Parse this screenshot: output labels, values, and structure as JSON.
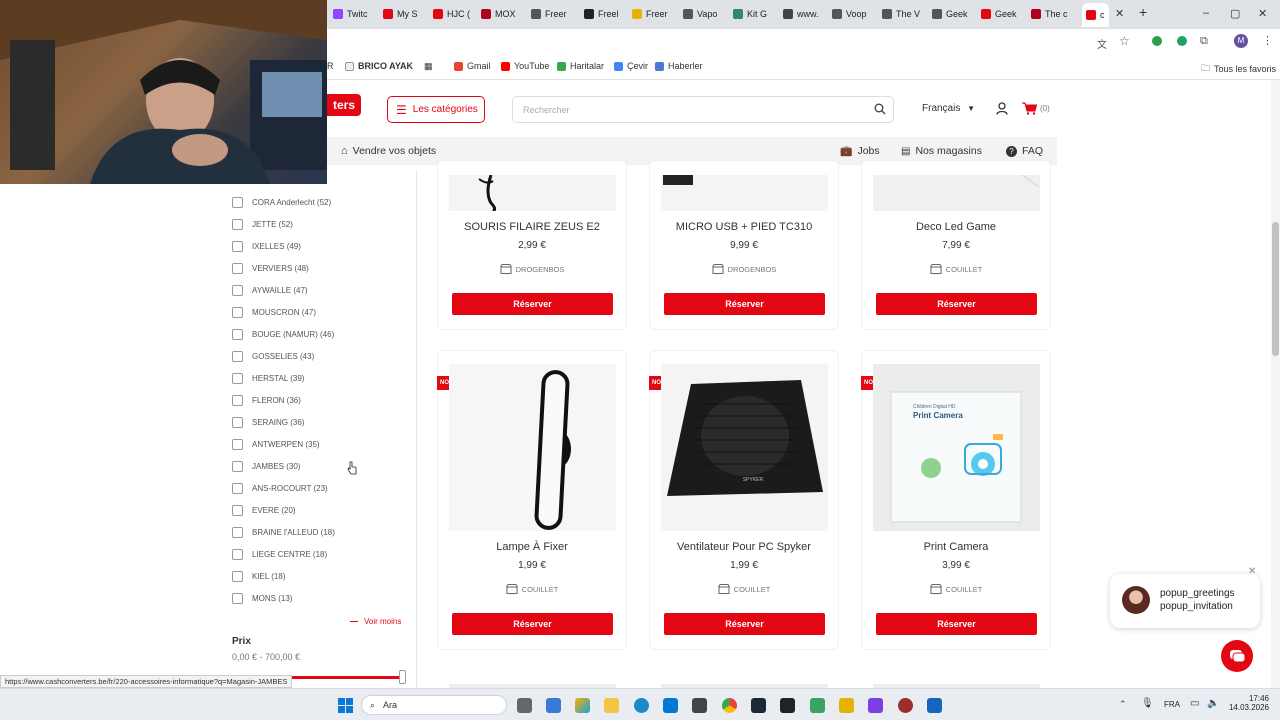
{
  "browser": {
    "tabs": [
      {
        "label": "Twitc",
        "color": "#9146ff"
      },
      {
        "label": "My S",
        "color": "#e30613"
      },
      {
        "label": "HJC (",
        "color": "#e30613"
      },
      {
        "label": "MOX",
        "color": "#b00020"
      },
      {
        "label": "Freer",
        "color": "#555555"
      },
      {
        "label": "Freel",
        "color": "#222222"
      },
      {
        "label": "Freer",
        "color": "#e8b400"
      },
      {
        "label": "Vapo",
        "color": "#555555"
      },
      {
        "label": "Kit G",
        "color": "#2a8a6a"
      },
      {
        "label": "www.",
        "color": "#444444"
      },
      {
        "label": "Voop",
        "color": "#555555"
      },
      {
        "label": "The V",
        "color": "#555555"
      },
      {
        "label": "Geek",
        "color": "#555555"
      },
      {
        "label": "Geek",
        "color": "#e30613"
      },
      {
        "label": "The c",
        "color": "#b00020"
      },
      {
        "label": "c",
        "color": "#e30613"
      }
    ],
    "bookmarks": [
      "R",
      "BRICO AYAK",
      "Gmail",
      "YouTube",
      "Haritalar",
      "Çevir",
      "Haberler"
    ],
    "all_bookmarks": "Tous les favoris",
    "profile_initial": "M",
    "status_url": "https://www.cashconverters.be/fr/220-accessoires-informatique?q=Magasin-JAMBES"
  },
  "header": {
    "logo_text": "ters",
    "categories_label": "Les catégories",
    "search_placeholder": "Rechercher",
    "language": "Français",
    "cart_count": "(0)",
    "sell_label": "Vendre vos objets",
    "jobs_label": "Jobs",
    "stores_label": "Nos magasins",
    "faq_label": "FAQ"
  },
  "sidebar": {
    "stores": [
      "CORA Anderlecht (52)",
      "JETTE (52)",
      "IXELLES (49)",
      "VERVIERS (48)",
      "AYWAILLE (47)",
      "MOUSCRON (47)",
      "BOUGE (NAMUR) (46)",
      "GOSSELIES (43)",
      "HERSTAL (39)",
      "FLERON (36)",
      "SERAING (36)",
      "ANTWERPEN (35)",
      "JAMBES (30)",
      "ANS-ROCOURT (23)",
      "EVERE (20)",
      "BRAINE l'ALLEUD (18)",
      "LIEGE CENTRE (18)",
      "KIEL (18)",
      "MONS (13)"
    ],
    "see_less": "Voir moins",
    "price_title": "Prix",
    "price_range": "0,00 € - 700,00 €"
  },
  "products": [
    {
      "title": "SOURIS FILAIRE ZEUS E2",
      "price": "2,99 €",
      "store": "DROGENBOS",
      "button": "Réserver",
      "badge": ""
    },
    {
      "title": "MICRO USB + PIED TC310",
      "price": "9,99 €",
      "store": "DROGENBOS",
      "button": "Réserver",
      "badge": ""
    },
    {
      "title": "Deco Led Game",
      "price": "7,99 €",
      "store": "COUILLET",
      "button": "Réserver",
      "badge": ""
    },
    {
      "title": "Lampe À Fixer",
      "price": "1,99 €",
      "store": "COUILLET",
      "button": "Réserver",
      "badge": "NOUVEAU"
    },
    {
      "title": "Ventilateur Pour PC Spyker",
      "price": "1,99 €",
      "store": "COUILLET",
      "button": "Réserver",
      "badge": "NOUVEAU"
    },
    {
      "title": "Print Camera",
      "price": "3,99 €",
      "store": "COUILLET",
      "button": "Réserver",
      "badge": "NOUVEAU"
    }
  ],
  "product_image_text": {
    "fan_brand": "SPYKER",
    "camera_box_line1": "Children Digital HD",
    "camera_box_line2": "Print Camera"
  },
  "chat": {
    "line1": "popup_greetings",
    "line2": "popup_invitation"
  },
  "taskbar": {
    "search_label": "Ara",
    "lang": "FRA",
    "time": "17:46",
    "date": "14.03.2026"
  }
}
